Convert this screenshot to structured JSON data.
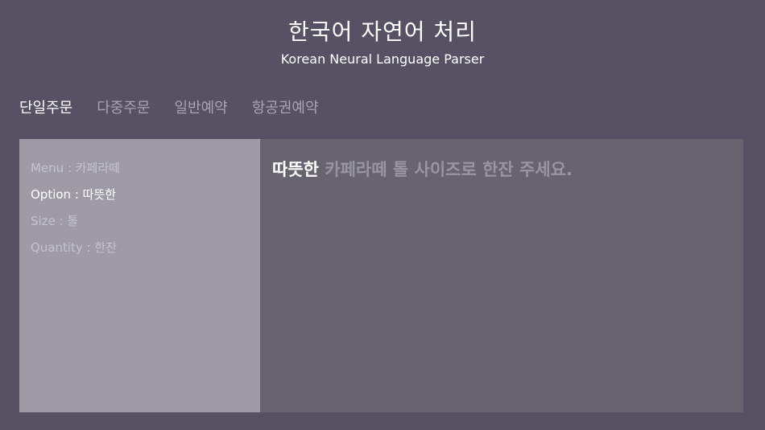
{
  "header": {
    "title": "한국어 자연어 처리",
    "subtitle": "Korean Neural Language Parser"
  },
  "tabs": [
    {
      "label": "단일주문",
      "active": true
    },
    {
      "label": "다중주문",
      "active": false
    },
    {
      "label": "일반예약",
      "active": false
    },
    {
      "label": "항공권예약",
      "active": false
    }
  ],
  "slots": [
    {
      "label": "Menu : 카페라떼",
      "active": false
    },
    {
      "label": "Option : 따뜻한",
      "active": true
    },
    {
      "label": "Size : 톨",
      "active": false
    },
    {
      "label": "Quantity : 한잔",
      "active": false
    }
  ],
  "sentence": {
    "highlight": "따뜻한",
    "rest": " 카페라떼 톨 사이즈로 한잔 주세요."
  },
  "colors": {
    "background": "#575263",
    "left_panel": "#9e9ba6",
    "right_panel": "#67646f",
    "active_text": "#ffffff",
    "inactive_tab": "#a8a4b1"
  }
}
